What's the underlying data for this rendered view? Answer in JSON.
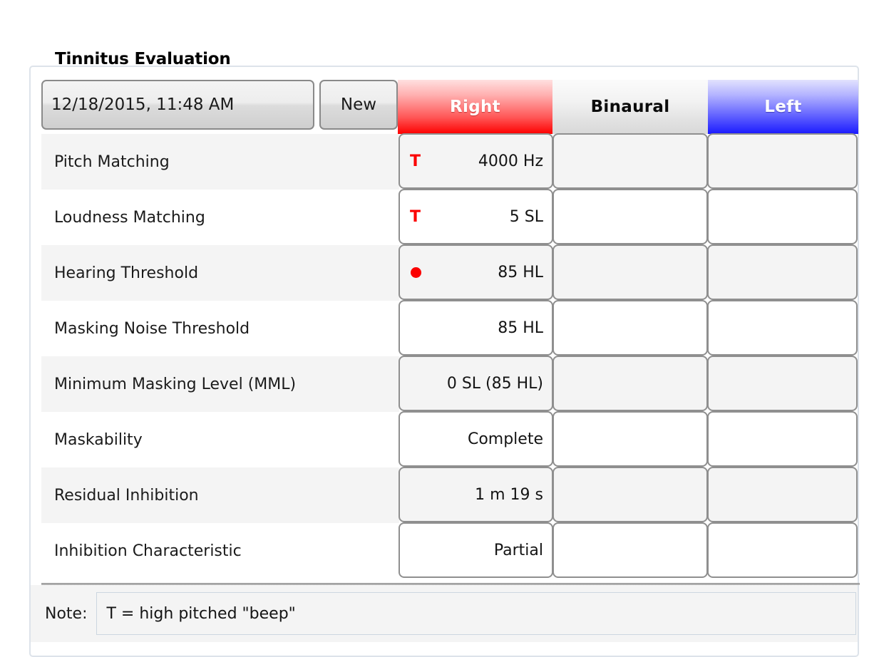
{
  "group": {
    "legend": "Tinnitus Evaluation"
  },
  "header": {
    "date_value": "12/18/2015, 11:48 AM",
    "new_label": "New",
    "columns": [
      {
        "key": "right",
        "label": "Right",
        "color": "#fe0000"
      },
      {
        "key": "binaural",
        "label": "Binaural",
        "color": "#d8d8d8"
      },
      {
        "key": "left",
        "label": "Left",
        "color": "#1a1aff"
      }
    ]
  },
  "rows": [
    {
      "label": "Pitch Matching",
      "right": {
        "marker": "T",
        "value": "4000 Hz"
      },
      "binaural": {
        "marker": "",
        "value": ""
      },
      "left": {
        "marker": "",
        "value": ""
      }
    },
    {
      "label": "Loudness Matching",
      "right": {
        "marker": "T",
        "value": "5 SL"
      },
      "binaural": {
        "marker": "",
        "value": ""
      },
      "left": {
        "marker": "",
        "value": ""
      }
    },
    {
      "label": "Hearing Threshold",
      "right": {
        "marker": "dot",
        "value": "85 HL"
      },
      "binaural": {
        "marker": "",
        "value": ""
      },
      "left": {
        "marker": "",
        "value": ""
      }
    },
    {
      "label": "Masking Noise Threshold",
      "right": {
        "marker": "",
        "value": "85 HL"
      },
      "binaural": {
        "marker": "",
        "value": ""
      },
      "left": {
        "marker": "",
        "value": ""
      }
    },
    {
      "label": "Minimum Masking Level (MML)",
      "right": {
        "marker": "",
        "value": "0 SL (85 HL)"
      },
      "binaural": {
        "marker": "",
        "value": ""
      },
      "left": {
        "marker": "",
        "value": ""
      }
    },
    {
      "label": "Maskability",
      "right": {
        "marker": "",
        "value": "Complete"
      },
      "binaural": {
        "marker": "",
        "value": ""
      },
      "left": {
        "marker": "",
        "value": ""
      }
    },
    {
      "label": "Residual Inhibition",
      "right": {
        "marker": "",
        "value": "1 m 19 s"
      },
      "binaural": {
        "marker": "",
        "value": ""
      },
      "left": {
        "marker": "",
        "value": ""
      }
    },
    {
      "label": "Inhibition Characteristic",
      "right": {
        "marker": "",
        "value": "Partial"
      },
      "binaural": {
        "marker": "",
        "value": ""
      },
      "left": {
        "marker": "",
        "value": ""
      }
    }
  ],
  "note": {
    "label": "Note:",
    "value": "T = high pitched \"beep\""
  }
}
